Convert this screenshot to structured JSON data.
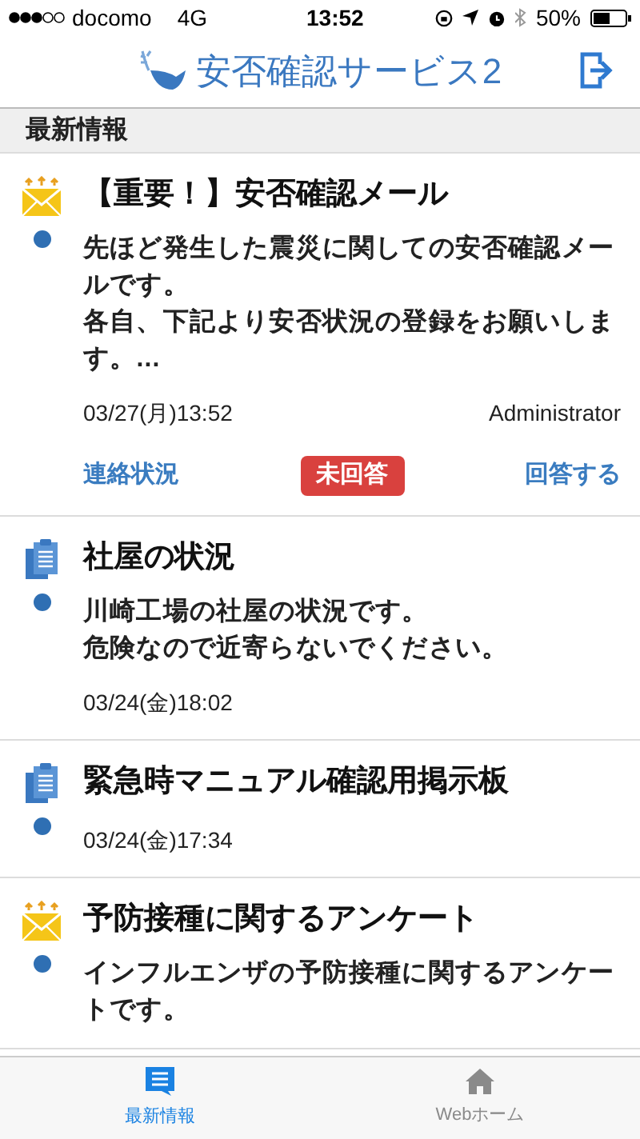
{
  "status_bar": {
    "carrier": "docomo",
    "network": "4G",
    "time": "13:52",
    "battery": "50%"
  },
  "header": {
    "title": "安否確認サービス2"
  },
  "section": {
    "title": "最新情報"
  },
  "items": [
    {
      "kind": "mail",
      "unread": true,
      "title": "【重要！】安否確認メール",
      "body": [
        "先ほど発生した震災に関しての安否確認メールです。",
        "各自、下記より安否状況の登録をお願いします。..."
      ],
      "date": "03/27(月)13:52",
      "author": "Administrator",
      "actions": {
        "left": "連絡状況",
        "status": "未回答",
        "right": "回答する"
      }
    },
    {
      "kind": "board",
      "unread": true,
      "title": "社屋の状況",
      "body": [
        "川崎工場の社屋の状況です。",
        "危険なので近寄らないでください。"
      ],
      "date": "03/24(金)18:02"
    },
    {
      "kind": "board",
      "unread": true,
      "title": "緊急時マニュアル確認用掲示板",
      "date": "03/24(金)17:34"
    },
    {
      "kind": "mail",
      "unread": true,
      "title": "予防接種に関するアンケート",
      "body": [
        "インフルエンザの予防接種に関するアンケートです。"
      ]
    }
  ],
  "tabs": [
    {
      "label": "最新情報",
      "selected": true,
      "kind": "news"
    },
    {
      "label": "Webホーム",
      "selected": false,
      "kind": "home"
    }
  ]
}
